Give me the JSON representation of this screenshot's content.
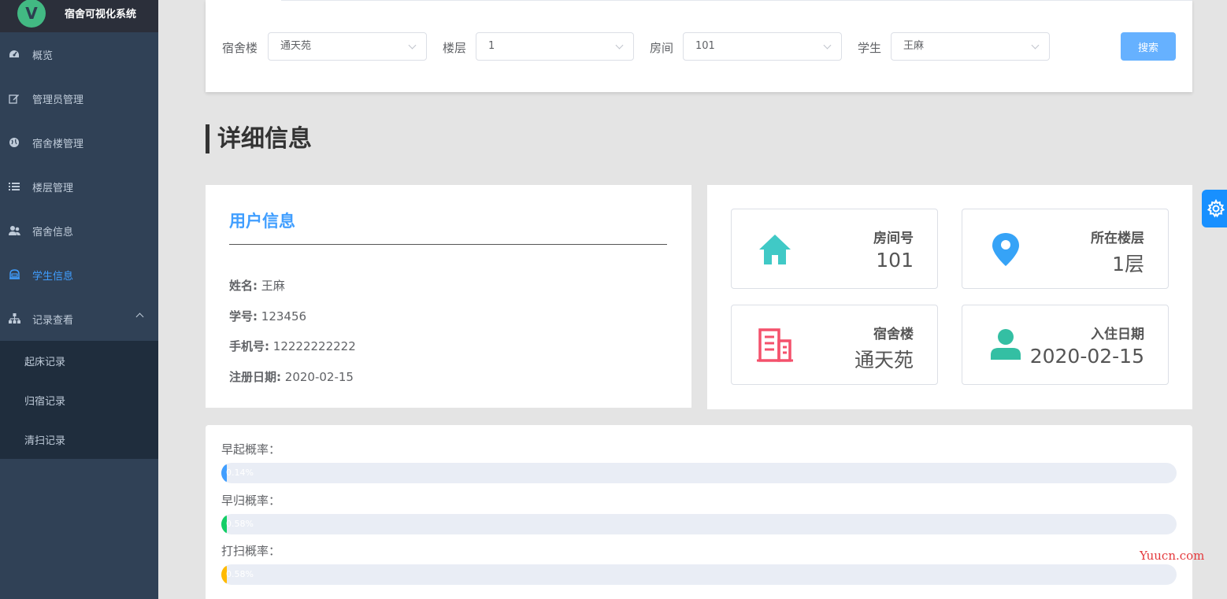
{
  "app": {
    "logo_letter": "V",
    "title": "宿舍可视化系统"
  },
  "sidebar": {
    "items": [
      {
        "label": "概览",
        "icon": "dashboard-icon"
      },
      {
        "label": "管理员管理",
        "icon": "edit-icon"
      },
      {
        "label": "宿舍楼管理",
        "icon": "globe-icon"
      },
      {
        "label": "楼层管理",
        "icon": "list-icon"
      },
      {
        "label": "宿舍信息",
        "icon": "users-icon"
      },
      {
        "label": "学生信息",
        "icon": "student-icon",
        "active": true
      },
      {
        "label": "记录查看",
        "icon": "sitemap-icon",
        "expanded": true
      }
    ],
    "subitems": [
      {
        "label": "起床记录"
      },
      {
        "label": "归宿记录"
      },
      {
        "label": "清扫记录"
      }
    ]
  },
  "filters": {
    "building": {
      "label": "宿舍楼",
      "value": "通天苑"
    },
    "floor": {
      "label": "楼层",
      "value": "1"
    },
    "room": {
      "label": "房间",
      "value": "101"
    },
    "student": {
      "label": "学生",
      "value": "王麻"
    },
    "search_label": "搜索"
  },
  "section_title": "详细信息",
  "user_info": {
    "title": "用户信息",
    "name_label": "姓名:",
    "name": "王麻",
    "id_label": "学号:",
    "id": "123456",
    "phone_label": "手机号:",
    "phone": "12222222222",
    "reg_label": "注册日期:",
    "reg_date": "2020-02-15"
  },
  "stats": {
    "room": {
      "label": "房间号",
      "value": "101",
      "icon": "home-icon",
      "color": "#40c9c6"
    },
    "floor": {
      "label": "所在楼层",
      "value": "1层",
      "icon": "location-pin-icon",
      "color": "#36a3f7"
    },
    "building": {
      "label": "宿舍楼",
      "value": "通天苑",
      "icon": "building-icon",
      "color": "#f4516c"
    },
    "checkin": {
      "label": "入住日期",
      "value": "2020-02-15",
      "icon": "person-icon",
      "color": "#34bfa3"
    }
  },
  "probabilities": [
    {
      "label": "早起概率：",
      "text": "0.14%",
      "percent": 0.14,
      "color": "#409eff"
    },
    {
      "label": "早归概率：",
      "text": "0.58%",
      "percent": 0.58,
      "color": "#13ce66"
    },
    {
      "label": "打扫概率：",
      "text": "0.58%",
      "percent": 0.58,
      "color": "#ffba00"
    }
  ],
  "watermark": "Yuucn.com"
}
